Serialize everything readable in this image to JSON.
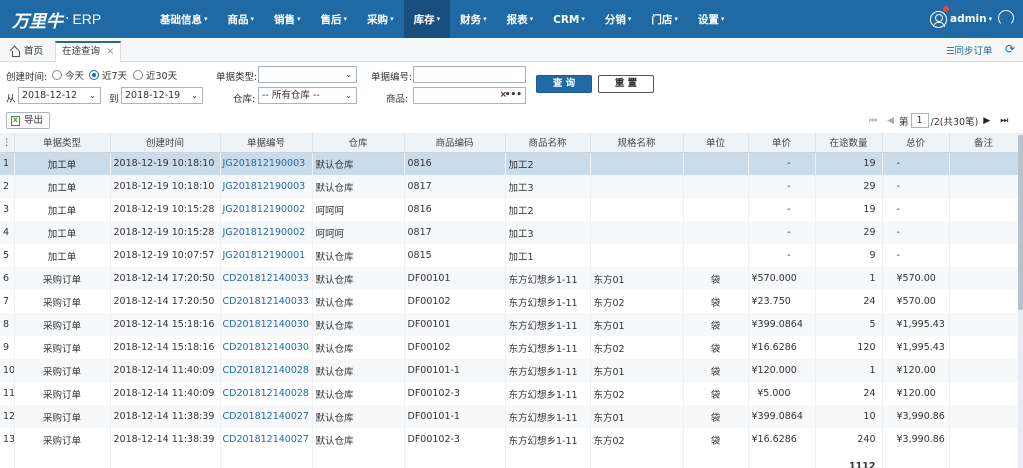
{
  "app": {
    "logo": "万里牛",
    "logo_suffix": "ERP",
    "nav": [
      {
        "label": "基础信息",
        "active": false
      },
      {
        "label": "商品",
        "active": false
      },
      {
        "label": "销售",
        "active": false
      },
      {
        "label": "售后",
        "active": false
      },
      {
        "label": "采购",
        "active": false
      },
      {
        "label": "库存",
        "active": true
      },
      {
        "label": "财务",
        "active": false
      },
      {
        "label": "报表",
        "active": false
      },
      {
        "label": "CRM",
        "active": false
      },
      {
        "label": "分销",
        "active": false
      },
      {
        "label": "门店",
        "active": false
      },
      {
        "label": "设置",
        "active": false
      }
    ],
    "user": "admin",
    "colors": {
      "nav_bg": "#1f6aa5",
      "selected_row": "#c8dcec",
      "link": "#1f6aa5"
    }
  },
  "tabs": {
    "home": "首页",
    "current": "在途查询",
    "close": "×",
    "sync": "☰同步订单",
    "refresh": "⟳"
  },
  "filters": {
    "created_label": "创建时间:",
    "radios": [
      {
        "label": "今天",
        "checked": false
      },
      {
        "label": "近7天",
        "checked": true
      },
      {
        "label": "近30天",
        "checked": false
      }
    ],
    "from_label": "从",
    "from_date": "2018-12-12",
    "to_label": "到",
    "to_date": "2018-12-19",
    "doc_type_label": "单据类型:",
    "doc_type_value": "",
    "warehouse_label": "仓库:",
    "warehouse_value": "-- 所有仓库 --",
    "doc_no_label": "单据编号:",
    "doc_no_value": "",
    "product_label": "商品:",
    "product_value": "",
    "query_button": "查 询",
    "reset_button": "重 置"
  },
  "toolbar": {
    "export": "导出",
    "page_label": "第",
    "page": "1",
    "page_info": "/2(共30笔)"
  },
  "table": {
    "columns": [
      "单据类型",
      "创建时间",
      "单据编号",
      "仓库",
      "商品编码",
      "商品名称",
      "规格名称",
      "单位",
      "单价",
      "在途数量",
      "总价",
      "备注"
    ],
    "rows": [
      [
        "1",
        "加工单",
        "2018-12-19 10:18:10",
        "JG201812190003",
        "默认仓库",
        "0816",
        "加工2",
        "",
        "",
        "-",
        "19",
        "-",
        ""
      ],
      [
        "2",
        "加工单",
        "2018-12-19 10:18:10",
        "JG201812190003",
        "默认仓库",
        "0817",
        "加工3",
        "",
        "",
        "-",
        "29",
        "-",
        ""
      ],
      [
        "3",
        "加工单",
        "2018-12-19 10:15:28",
        "JG201812190002",
        "呵呵呵",
        "0816",
        "加工2",
        "",
        "",
        "-",
        "19",
        "-",
        ""
      ],
      [
        "4",
        "加工单",
        "2018-12-19 10:15:28",
        "JG201812190002",
        "呵呵呵",
        "0817",
        "加工3",
        "",
        "",
        "-",
        "29",
        "-",
        ""
      ],
      [
        "5",
        "加工单",
        "2018-12-19 10:07:57",
        "JG201812190001",
        "默认仓库",
        "0815",
        "加工1",
        "",
        "",
        "-",
        "9",
        "-",
        ""
      ],
      [
        "6",
        "采购订单",
        "2018-12-14 17:20:50",
        "CD201812140033",
        "默认仓库",
        "DF00101",
        "东方幻想乡1-11",
        "东方01",
        "袋",
        "¥570.000",
        "1",
        "¥570.00",
        ""
      ],
      [
        "7",
        "采购订单",
        "2018-12-14 17:20:50",
        "CD201812140033",
        "默认仓库",
        "DF00102",
        "东方幻想乡1-11",
        "东方02",
        "袋",
        "¥23.750",
        "24",
        "¥570.00",
        ""
      ],
      [
        "8",
        "采购订单",
        "2018-12-14 15:18:16",
        "CD201812140030",
        "默认仓库",
        "DF00101",
        "东方幻想乡1-11",
        "东方01",
        "袋",
        "¥399.0864",
        "5",
        "¥1,995.43",
        ""
      ],
      [
        "9",
        "采购订单",
        "2018-12-14 15:18:16",
        "CD201812140030",
        "默认仓库",
        "DF00102",
        "东方幻想乡1-11",
        "东方02",
        "袋",
        "¥16.6286",
        "120",
        "¥1,995.43",
        ""
      ],
      [
        "10",
        "采购订单",
        "2018-12-14 11:40:09",
        "CD201812140028",
        "默认仓库",
        "DF00101-1",
        "东方幻想乡1-11",
        "东方01",
        "袋",
        "¥120.000",
        "1",
        "¥120.00",
        ""
      ],
      [
        "11",
        "采购订单",
        "2018-12-14 11:40:09",
        "CD201812140028",
        "默认仓库",
        "DF00102-3",
        "东方幻想乡1-11",
        "东方02",
        "袋",
        "¥5.000",
        "24",
        "¥120.00",
        ""
      ],
      [
        "12",
        "采购订单",
        "2018-12-14 11:38:39",
        "CD201812140027",
        "默认仓库",
        "DF00101-1",
        "东方幻想乡1-11",
        "东方01",
        "袋",
        "¥399.0864",
        "10",
        "¥3,990.86",
        ""
      ],
      [
        "13",
        "采购订单",
        "2018-12-14 11:38:39",
        "CD201812140027",
        "默认仓库",
        "DF00102-3",
        "东方幻想乡1-11",
        "东方02",
        "袋",
        "¥16.6286",
        "240",
        "¥3,990.86",
        ""
      ]
    ],
    "total_quantity": "1112"
  }
}
